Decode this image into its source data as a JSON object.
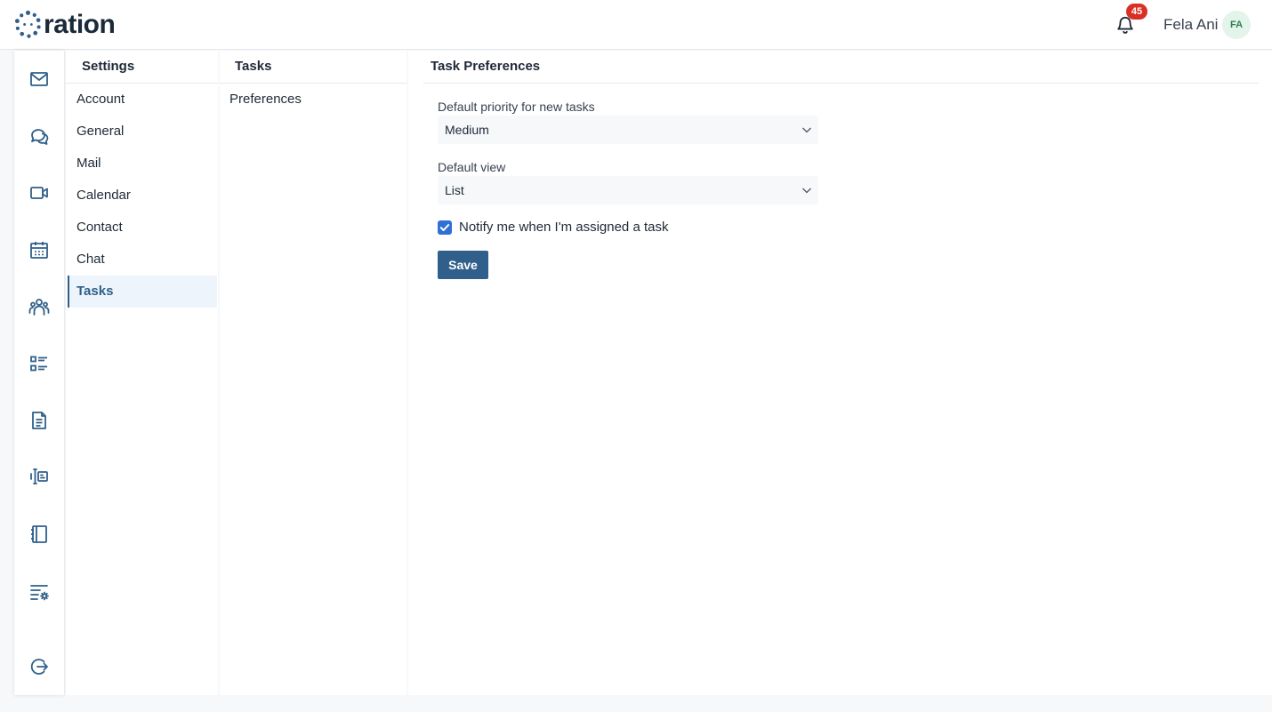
{
  "header": {
    "logo_text": "ration",
    "notification_count": "45",
    "user_name": "Fela Ani",
    "user_initials": "FA"
  },
  "rail": {
    "icons": [
      "mail-icon",
      "chat-icon",
      "video-icon",
      "calendar-icon",
      "contacts-icon",
      "tasks-icon",
      "document-icon",
      "kanban-icon",
      "notebook-icon",
      "settings-list-icon",
      "logout-icon"
    ]
  },
  "settings": {
    "title": "Settings",
    "items": [
      {
        "label": "Account"
      },
      {
        "label": "General"
      },
      {
        "label": "Mail"
      },
      {
        "label": "Calendar"
      },
      {
        "label": "Contact"
      },
      {
        "label": "Chat"
      },
      {
        "label": "Tasks",
        "active": true
      }
    ]
  },
  "tasks_menu": {
    "title": "Tasks",
    "items": [
      {
        "label": "Preferences"
      }
    ]
  },
  "preferences": {
    "title": "Task Preferences",
    "priority_label": "Default priority for new tasks",
    "priority_value": "Medium",
    "view_label": "Default view",
    "view_value": "List",
    "notify_label": "Notify me when I'm assigned a task",
    "notify_checked": true,
    "save_label": "Save"
  },
  "colors": {
    "accent": "#2f5f8a",
    "checkbox": "#2f6fd6",
    "badge": "#d93025",
    "avatar_bg": "#e3f4ea"
  }
}
